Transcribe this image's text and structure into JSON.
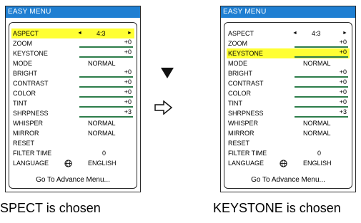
{
  "left_panel": {
    "title": "EASY MENU",
    "rows": {
      "aspect": {
        "label": "ASPECT",
        "value": "4:3",
        "left_arrow": "◄",
        "right_arrow": "►"
      },
      "zoom": {
        "label": "ZOOM",
        "value": "+0"
      },
      "keystone": {
        "label": "KEYSTONE",
        "value": "+0"
      },
      "mode": {
        "label": "MODE",
        "value": "NORMAL"
      },
      "bright": {
        "label": "BRIGHT",
        "value": "+0"
      },
      "contrast": {
        "label": "CONTRAST",
        "value": "+0"
      },
      "color": {
        "label": "COLOR",
        "value": "+0"
      },
      "tint": {
        "label": "TINT",
        "value": "+0"
      },
      "sharpness": {
        "label": "SHRPNESS",
        "value": "+3"
      },
      "whisper": {
        "label": "WHISPER",
        "value": "NORMAL"
      },
      "mirror": {
        "label": "MIRROR",
        "value": "NORMAL"
      },
      "reset": {
        "label": "RESET"
      },
      "filter_time": {
        "label": "FILTER TIME",
        "value": "0"
      },
      "language": {
        "label": "LANGUAGE",
        "value": "ENGLISH"
      }
    },
    "advance_label": "Go To Advance Menu...",
    "highlighted": "ASPECT"
  },
  "right_panel": {
    "title": "EASY MENU",
    "rows": {
      "aspect": {
        "label": "ASPECT",
        "value": "4:3",
        "left_arrow": "◄",
        "right_arrow": "►"
      },
      "zoom": {
        "label": "ZOOM",
        "value": "+0"
      },
      "keystone": {
        "label": "KEYSTONE",
        "value": "+0"
      },
      "mode": {
        "label": "MODE",
        "value": "NORMAL"
      },
      "bright": {
        "label": "BRIGHT",
        "value": "+0"
      },
      "contrast": {
        "label": "CONTRAST",
        "value": "+0"
      },
      "color": {
        "label": "COLOR",
        "value": "+0"
      },
      "tint": {
        "label": "TINT",
        "value": "+0"
      },
      "sharpness": {
        "label": "SHRPNESS",
        "value": "+3"
      },
      "whisper": {
        "label": "WHISPER",
        "value": "NORMAL"
      },
      "mirror": {
        "label": "MIRROR",
        "value": "NORMAL"
      },
      "reset": {
        "label": "RESET"
      },
      "filter_time": {
        "label": "FILTER TIME",
        "value": "0"
      },
      "language": {
        "label": "LANGUAGE",
        "value": "ENGLISH"
      }
    },
    "advance_label": "Go To Advance Menu...",
    "highlighted": "KEYSTONE"
  },
  "captions": {
    "left": "SPECT is chosen",
    "right": "KEYSTONE is chosen"
  },
  "colors": {
    "title_bar": "#1f7fd2",
    "highlight": "#ffff33",
    "bar_track": "#2d7d4a"
  },
  "icons": {
    "language_icon": "globe-icon",
    "down_arrow": "down-triangle-icon",
    "right_arrow": "right-hollow-arrow-icon"
  }
}
